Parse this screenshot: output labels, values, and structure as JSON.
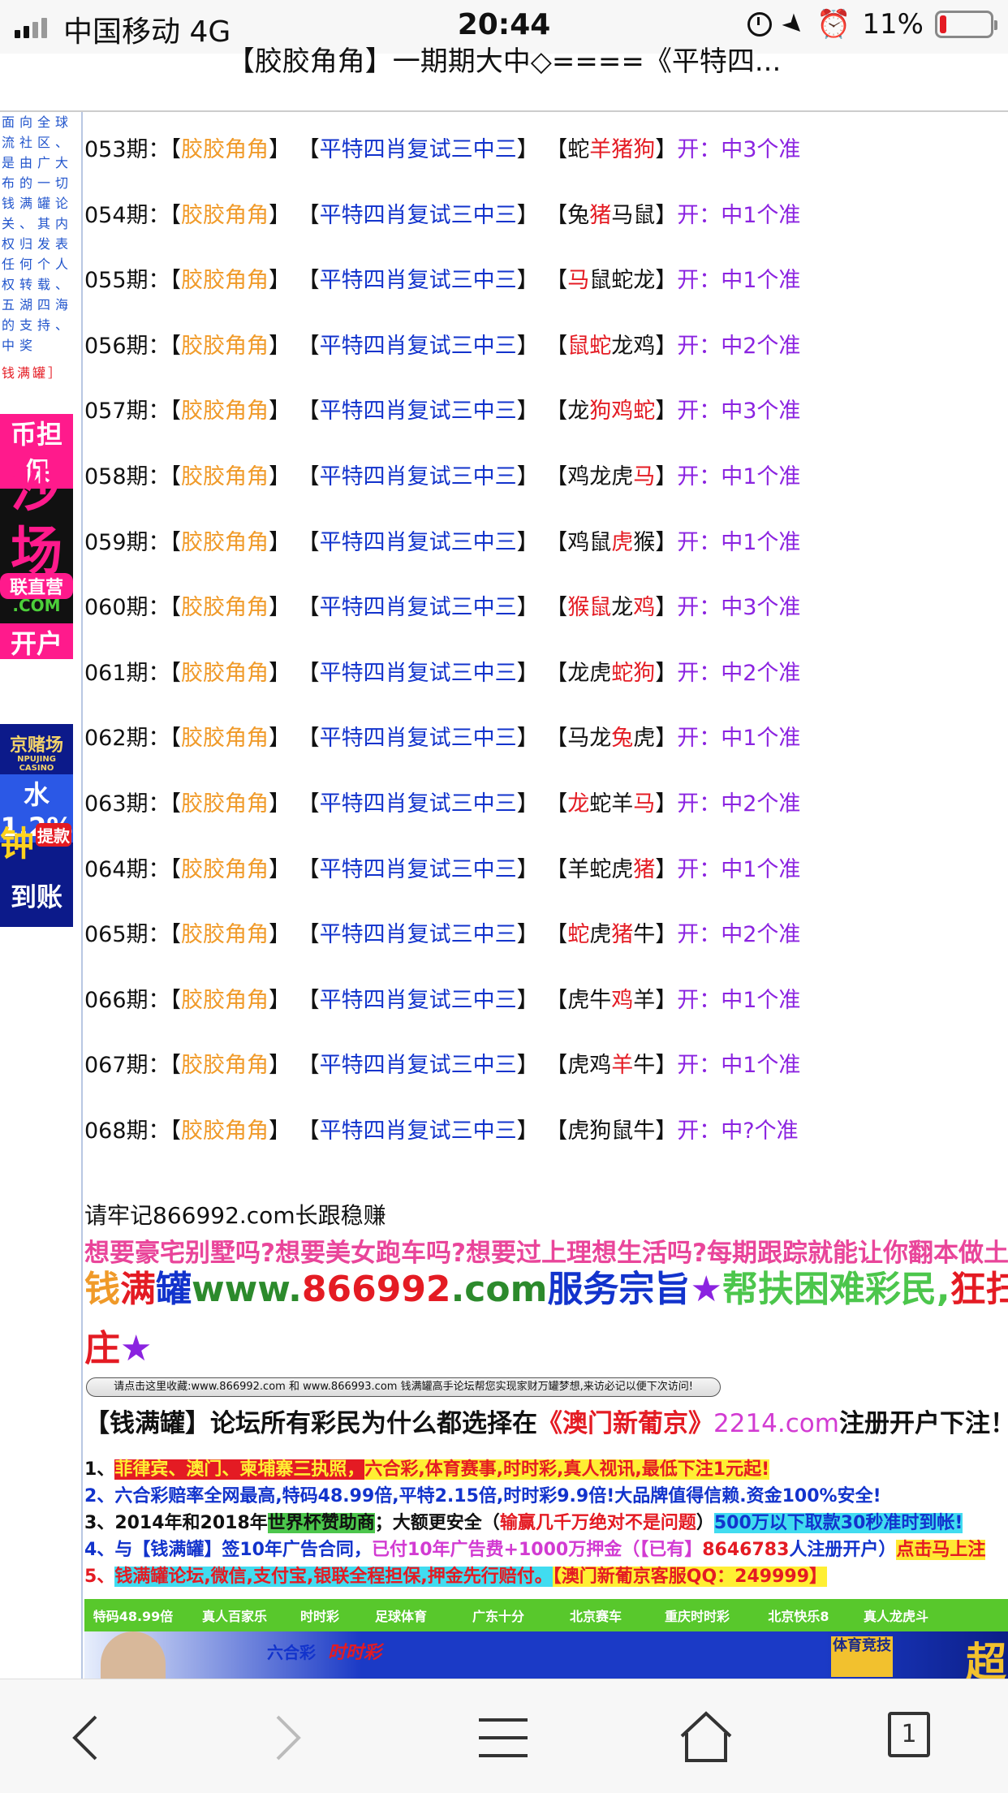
{
  "status": {
    "carrier": "中国移动  4G",
    "time": "20:44",
    "battery": "11%",
    "battery_level": 0.11
  },
  "page_title": "【胶胶角角】一期期大中◇====《平特四...",
  "sidebar": {
    "note": "面向全球流社区、是由广大布的一切钱满罐论关、其内权归发表任何个人权转载、五湖四海的支持、中奖",
    "note_end": "钱满罐］",
    "ad1": {
      "line1": "币担保",
      "line2": "沙",
      "line3": "场",
      "line4": "联直营",
      "line5": ".COM",
      "line6": "开户"
    },
    "ad2": {
      "line1": "京赌场",
      "line2": "NPUJING CASINO",
      "line3": "水1.2%",
      "line4": "钟",
      "line5": "提款",
      "line6": "到账"
    }
  },
  "rows": [
    {
      "period": "053期：",
      "group": "胶胶角角",
      "pred": "平特四肖复试三中三",
      "z": [
        [
          "蛇",
          "b"
        ],
        [
          "羊猪狗",
          "r"
        ]
      ],
      "result": "开：中3个准"
    },
    {
      "period": "054期：",
      "group": "胶胶角角",
      "pred": "平特四肖复试三中三",
      "z": [
        [
          "兔",
          "b"
        ],
        [
          "猪",
          "r"
        ],
        [
          "马鼠",
          "b"
        ]
      ],
      "result": "开：中1个准"
    },
    {
      "period": "055期：",
      "group": "胶胶角角",
      "pred": "平特四肖复试三中三",
      "z": [
        [
          "马",
          "r"
        ],
        [
          "鼠蛇龙",
          "b"
        ]
      ],
      "result": "开：中1个准"
    },
    {
      "period": "056期：",
      "group": "胶胶角角",
      "pred": "平特四肖复试三中三",
      "z": [
        [
          "鼠蛇",
          "r"
        ],
        [
          "龙鸡",
          "b"
        ]
      ],
      "result": "开：中2个准"
    },
    {
      "period": "057期：",
      "group": "胶胶角角",
      "pred": "平特四肖复试三中三",
      "z": [
        [
          "龙",
          "b"
        ],
        [
          "狗鸡蛇",
          "r"
        ]
      ],
      "result": "开：中3个准"
    },
    {
      "period": "058期：",
      "group": "胶胶角角",
      "pred": "平特四肖复试三中三",
      "z": [
        [
          "鸡龙虎",
          "b"
        ],
        [
          "马",
          "r"
        ]
      ],
      "result": "开：中1个准"
    },
    {
      "period": "059期：",
      "group": "胶胶角角",
      "pred": "平特四肖复试三中三",
      "z": [
        [
          "鸡鼠",
          "b"
        ],
        [
          "虎",
          "r"
        ],
        [
          "猴",
          "b"
        ]
      ],
      "result": "开：中1个准"
    },
    {
      "period": "060期：",
      "group": "胶胶角角",
      "pred": "平特四肖复试三中三",
      "z": [
        [
          "猴鼠",
          "r"
        ],
        [
          "龙",
          "b"
        ],
        [
          "鸡",
          "r"
        ]
      ],
      "result": "开：中3个准"
    },
    {
      "period": "061期：",
      "group": "胶胶角角",
      "pred": "平特四肖复试三中三",
      "z": [
        [
          "龙虎",
          "b"
        ],
        [
          "蛇狗",
          "r"
        ]
      ],
      "result": "开：中2个准"
    },
    {
      "period": "062期：",
      "group": "胶胶角角",
      "pred": "平特四肖复试三中三",
      "z": [
        [
          "马龙",
          "b"
        ],
        [
          "兔",
          "r"
        ],
        [
          "虎",
          "b"
        ]
      ],
      "result": "开：中1个准"
    },
    {
      "period": "063期：",
      "group": "胶胶角角",
      "pred": "平特四肖复试三中三",
      "z": [
        [
          "龙",
          "r"
        ],
        [
          "蛇羊",
          "b"
        ],
        [
          "马",
          "r"
        ]
      ],
      "result": "开：中2个准"
    },
    {
      "period": "064期：",
      "group": "胶胶角角",
      "pred": "平特四肖复试三中三",
      "z": [
        [
          "羊蛇虎",
          "b"
        ],
        [
          "猪",
          "r"
        ]
      ],
      "result": "开：中1个准"
    },
    {
      "period": "065期：",
      "group": "胶胶角角",
      "pred": "平特四肖复试三中三",
      "z": [
        [
          "蛇",
          "r"
        ],
        [
          "虎",
          "b"
        ],
        [
          "猪",
          "r"
        ],
        [
          "牛",
          "b"
        ]
      ],
      "result": "开：中2个准"
    },
    {
      "period": "066期：",
      "group": "胶胶角角",
      "pred": "平特四肖复试三中三",
      "z": [
        [
          "虎牛",
          "b"
        ],
        [
          "鸡",
          "r"
        ],
        [
          "羊",
          "b"
        ]
      ],
      "result": "开：中1个准"
    },
    {
      "period": "067期：",
      "group": "胶胶角角",
      "pred": "平特四肖复试三中三",
      "z": [
        [
          "虎鸡",
          "b"
        ],
        [
          "羊",
          "r"
        ],
        [
          "牛",
          "b"
        ]
      ],
      "result": "开：中1个准"
    },
    {
      "period": "068期：",
      "group": "胶胶角角",
      "pred": "平特四肖复试三中三",
      "z": [
        [
          "虎狗鼠牛",
          "b"
        ]
      ],
      "result": "开：中?个准"
    }
  ],
  "remember": "请牢记866992.com长跟稳赚",
  "want": "想要豪宅别墅吗?想要美女跑车吗?想要过上理想生活吗?每期跟踪就能让你翻本做土",
  "slogan": {
    "a": "钱",
    "b": "满",
    "c": "罐",
    "d": "www.",
    "e": "866992",
    "f": ".com",
    "g": "服务宗旨",
    "h": "★",
    "i": "帮扶困难彩民,",
    "j": "狂扫地",
    "k": "庄",
    "l": "★"
  },
  "fav_button": "请点击这里收藏:www.866992.com 和 www.866993.com 钱满罐高手论坛帮您实现家财万罐梦想,来访必记以便下次访问!",
  "why": {
    "a": "【钱满罐】论坛所有彩民为什么都选择在",
    "b": "《澳门新葡京》",
    "c": "2214.com",
    "d": "注册开户下注！"
  },
  "list": {
    "l1": {
      "n": "1、",
      "a": "菲律宾、澳门、柬埔寨三执照，",
      "b": "六合彩,体育赛事,时时彩,真人视讯,最低下注1元起!"
    },
    "l2": {
      "n": "2、",
      "a": "六合彩赔率全网最高,特码48.99倍,平特2.15倍,时时彩9.9倍!大品牌值得信赖.资金100%安全!"
    },
    "l3": {
      "n": "3、",
      "a": "2014年和2018年",
      "b": "世界杯赞助商",
      "c": "；大额更安全（",
      "d": "输赢几千万绝对不是问题",
      "e": "）",
      "f": "500万以下取款30秒准时到帐!"
    },
    "l4": {
      "n": "4、",
      "a": "与【钱满罐】签10年广告合同，",
      "b": "已付10年广告费+1000万押金（【已有】",
      "c": "8646783",
      "d": "人注册开户）",
      "e": "点击马上注"
    },
    "l5": {
      "n": "5、",
      "a": "钱满罐论坛,微信,支付宝,银联全程担保,押金先行赔付。",
      "b": "【澳门新葡京客服QQ：249999】"
    }
  },
  "nav": [
    "特码48.99倍",
    "真人百家乐",
    "时时彩",
    "足球体育",
    "广东十分",
    "北京赛车",
    "重庆时时彩",
    "北京快乐8",
    "真人龙虎斗"
  ],
  "banner": {
    "logo1": "六合彩",
    "logo2": "时时彩",
    "badge": "体育竞技",
    "big": "超"
  },
  "toolbar": {
    "tab_count": "1"
  },
  "colors": {
    "orange": "#f09a29",
    "blue": "#1233cc",
    "red": "#e41b23",
    "purple": "#8b23e0",
    "pink": "#e9459a",
    "green": "#58c82c"
  }
}
